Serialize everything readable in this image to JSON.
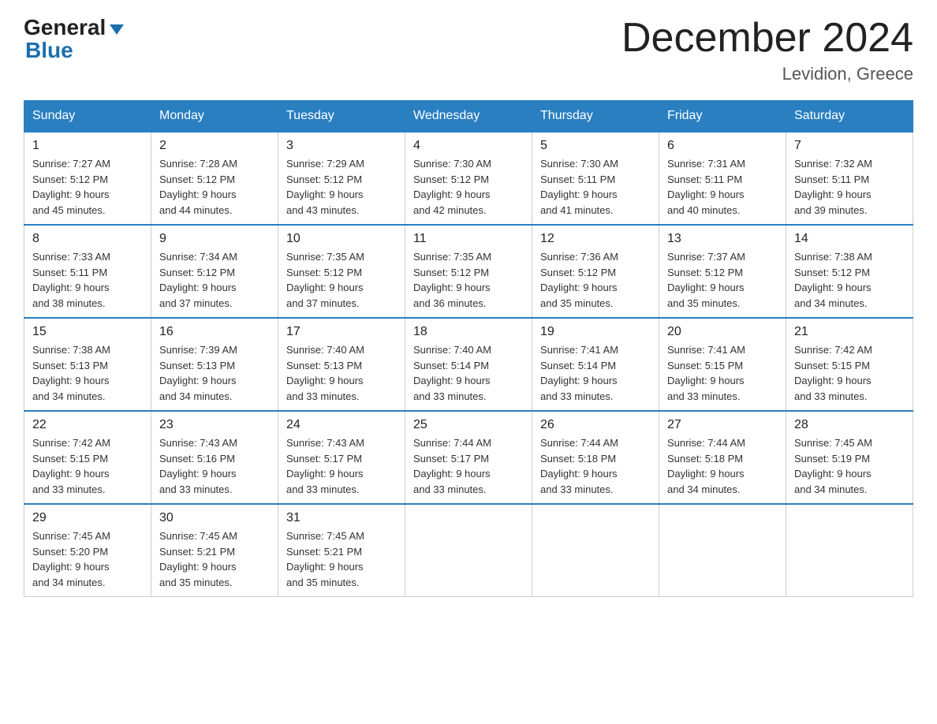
{
  "header": {
    "logo_general": "General",
    "logo_blue": "Blue",
    "month_title": "December 2024",
    "location": "Levidion, Greece"
  },
  "weekdays": [
    "Sunday",
    "Monday",
    "Tuesday",
    "Wednesday",
    "Thursday",
    "Friday",
    "Saturday"
  ],
  "weeks": [
    [
      {
        "day": "1",
        "sunrise": "7:27 AM",
        "sunset": "5:12 PM",
        "daylight": "9 hours and 45 minutes."
      },
      {
        "day": "2",
        "sunrise": "7:28 AM",
        "sunset": "5:12 PM",
        "daylight": "9 hours and 44 minutes."
      },
      {
        "day": "3",
        "sunrise": "7:29 AM",
        "sunset": "5:12 PM",
        "daylight": "9 hours and 43 minutes."
      },
      {
        "day": "4",
        "sunrise": "7:30 AM",
        "sunset": "5:12 PM",
        "daylight": "9 hours and 42 minutes."
      },
      {
        "day": "5",
        "sunrise": "7:30 AM",
        "sunset": "5:11 PM",
        "daylight": "9 hours and 41 minutes."
      },
      {
        "day": "6",
        "sunrise": "7:31 AM",
        "sunset": "5:11 PM",
        "daylight": "9 hours and 40 minutes."
      },
      {
        "day": "7",
        "sunrise": "7:32 AM",
        "sunset": "5:11 PM",
        "daylight": "9 hours and 39 minutes."
      }
    ],
    [
      {
        "day": "8",
        "sunrise": "7:33 AM",
        "sunset": "5:11 PM",
        "daylight": "9 hours and 38 minutes."
      },
      {
        "day": "9",
        "sunrise": "7:34 AM",
        "sunset": "5:12 PM",
        "daylight": "9 hours and 37 minutes."
      },
      {
        "day": "10",
        "sunrise": "7:35 AM",
        "sunset": "5:12 PM",
        "daylight": "9 hours and 37 minutes."
      },
      {
        "day": "11",
        "sunrise": "7:35 AM",
        "sunset": "5:12 PM",
        "daylight": "9 hours and 36 minutes."
      },
      {
        "day": "12",
        "sunrise": "7:36 AM",
        "sunset": "5:12 PM",
        "daylight": "9 hours and 35 minutes."
      },
      {
        "day": "13",
        "sunrise": "7:37 AM",
        "sunset": "5:12 PM",
        "daylight": "9 hours and 35 minutes."
      },
      {
        "day": "14",
        "sunrise": "7:38 AM",
        "sunset": "5:12 PM",
        "daylight": "9 hours and 34 minutes."
      }
    ],
    [
      {
        "day": "15",
        "sunrise": "7:38 AM",
        "sunset": "5:13 PM",
        "daylight": "9 hours and 34 minutes."
      },
      {
        "day": "16",
        "sunrise": "7:39 AM",
        "sunset": "5:13 PM",
        "daylight": "9 hours and 34 minutes."
      },
      {
        "day": "17",
        "sunrise": "7:40 AM",
        "sunset": "5:13 PM",
        "daylight": "9 hours and 33 minutes."
      },
      {
        "day": "18",
        "sunrise": "7:40 AM",
        "sunset": "5:14 PM",
        "daylight": "9 hours and 33 minutes."
      },
      {
        "day": "19",
        "sunrise": "7:41 AM",
        "sunset": "5:14 PM",
        "daylight": "9 hours and 33 minutes."
      },
      {
        "day": "20",
        "sunrise": "7:41 AM",
        "sunset": "5:15 PM",
        "daylight": "9 hours and 33 minutes."
      },
      {
        "day": "21",
        "sunrise": "7:42 AM",
        "sunset": "5:15 PM",
        "daylight": "9 hours and 33 minutes."
      }
    ],
    [
      {
        "day": "22",
        "sunrise": "7:42 AM",
        "sunset": "5:15 PM",
        "daylight": "9 hours and 33 minutes."
      },
      {
        "day": "23",
        "sunrise": "7:43 AM",
        "sunset": "5:16 PM",
        "daylight": "9 hours and 33 minutes."
      },
      {
        "day": "24",
        "sunrise": "7:43 AM",
        "sunset": "5:17 PM",
        "daylight": "9 hours and 33 minutes."
      },
      {
        "day": "25",
        "sunrise": "7:44 AM",
        "sunset": "5:17 PM",
        "daylight": "9 hours and 33 minutes."
      },
      {
        "day": "26",
        "sunrise": "7:44 AM",
        "sunset": "5:18 PM",
        "daylight": "9 hours and 33 minutes."
      },
      {
        "day": "27",
        "sunrise": "7:44 AM",
        "sunset": "5:18 PM",
        "daylight": "9 hours and 34 minutes."
      },
      {
        "day": "28",
        "sunrise": "7:45 AM",
        "sunset": "5:19 PM",
        "daylight": "9 hours and 34 minutes."
      }
    ],
    [
      {
        "day": "29",
        "sunrise": "7:45 AM",
        "sunset": "5:20 PM",
        "daylight": "9 hours and 34 minutes."
      },
      {
        "day": "30",
        "sunrise": "7:45 AM",
        "sunset": "5:21 PM",
        "daylight": "9 hours and 35 minutes."
      },
      {
        "day": "31",
        "sunrise": "7:45 AM",
        "sunset": "5:21 PM",
        "daylight": "9 hours and 35 minutes."
      },
      null,
      null,
      null,
      null
    ]
  ],
  "labels": {
    "sunrise": "Sunrise:",
    "sunset": "Sunset:",
    "daylight": "Daylight:"
  }
}
